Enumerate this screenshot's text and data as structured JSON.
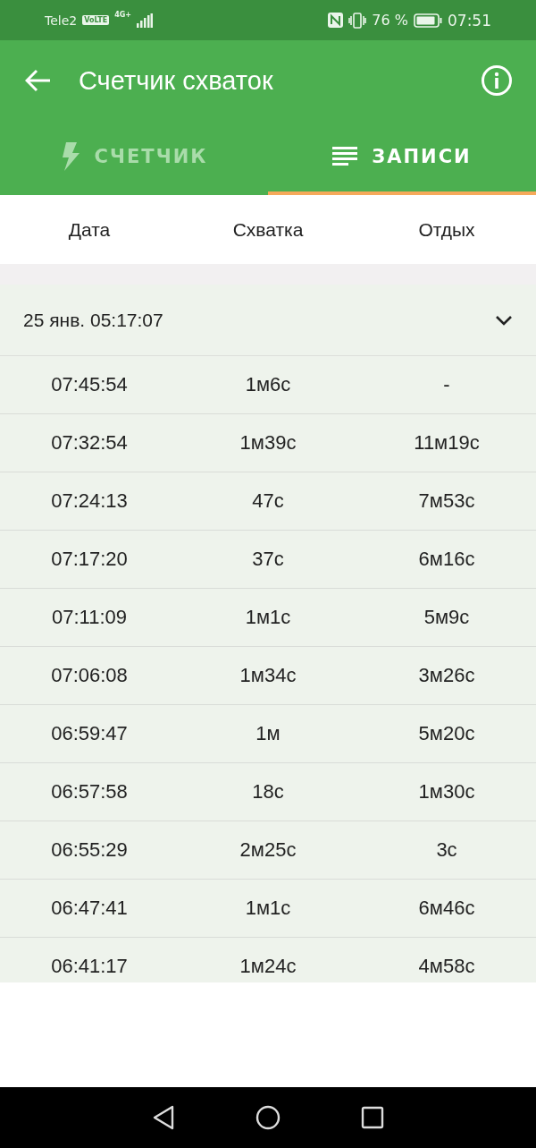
{
  "status_bar": {
    "carrier": "Tele2",
    "volte": "VoLTE",
    "network": "4G+",
    "battery": "76 %",
    "time": "07:51"
  },
  "app_bar": {
    "title": "Счетчик схваток"
  },
  "tabs": [
    {
      "label": "СЧЕТЧИК",
      "kind": "counter",
      "selected": false
    },
    {
      "label": "ЗАПИСИ",
      "kind": "records",
      "selected": true
    }
  ],
  "table": {
    "columns": [
      "Дата",
      "Схватка",
      "Отдых"
    ],
    "groups": [
      {
        "title": "25 янв. 05:17:07",
        "expanded": true,
        "rows": [
          [
            "07:45:54",
            "1м6с",
            "-"
          ],
          [
            "07:32:54",
            "1м39с",
            "11м19с"
          ],
          [
            "07:24:13",
            "47с",
            "7м53с"
          ],
          [
            "07:17:20",
            "37с",
            "6м16с"
          ],
          [
            "07:11:09",
            "1м1с",
            "5м9с"
          ],
          [
            "07:06:08",
            "1м34с",
            "3м26с"
          ],
          [
            "06:59:47",
            "1м",
            "5м20с"
          ],
          [
            "06:57:58",
            "18с",
            "1м30с"
          ],
          [
            "06:55:29",
            "2м25с",
            "3с"
          ],
          [
            "06:47:41",
            "1м1с",
            "6м46с"
          ],
          [
            "06:41:17",
            "1м24с",
            "4м58с"
          ]
        ]
      }
    ]
  }
}
